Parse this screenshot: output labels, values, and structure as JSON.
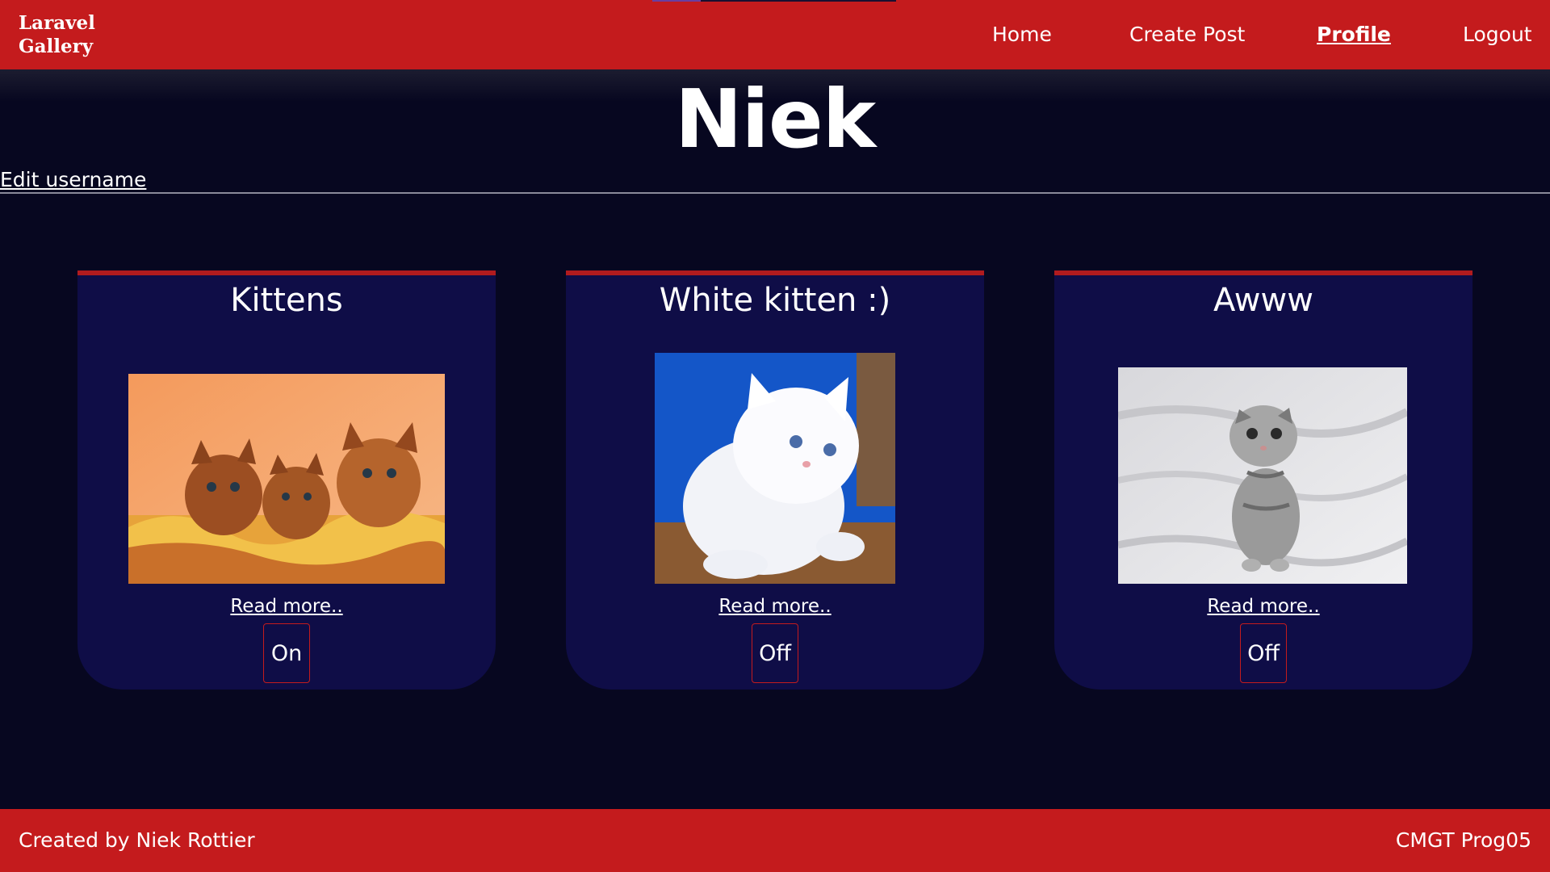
{
  "navbar": {
    "brand_line1": "Laravel",
    "brand_line2": "Gallery",
    "links": [
      {
        "label": "Home"
      },
      {
        "label": "Create Post"
      },
      {
        "label": "Profile",
        "active": true
      },
      {
        "label": "Logout"
      }
    ]
  },
  "profile": {
    "username": "Niek",
    "edit_link": "Edit username"
  },
  "posts": [
    {
      "title": "Kittens",
      "read_more": "Read more..",
      "toggle": "On",
      "image": "kittens-photo"
    },
    {
      "title": "White kitten :)",
      "read_more": "Read more..",
      "toggle": "Off",
      "image": "white-kitten-photo"
    },
    {
      "title": "Awww",
      "read_more": "Read more..",
      "toggle": "Off",
      "image": "grey-kitten-photo"
    }
  ],
  "footer": {
    "left": "Created by Niek Rottier",
    "right": "CMGT Prog05"
  },
  "colors": {
    "navbar": "#c41b1d",
    "background": "#070720",
    "card": "#0f0d47",
    "card_border": "#b01b1e"
  }
}
